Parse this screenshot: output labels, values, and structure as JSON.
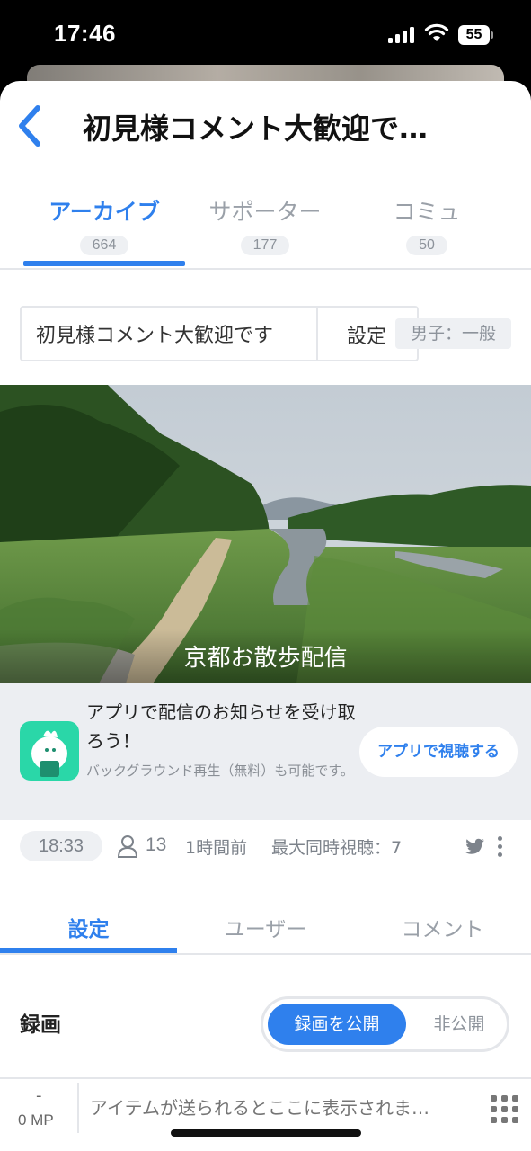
{
  "status_bar": {
    "time": "17:46",
    "battery": "55"
  },
  "header": {
    "title": "初見様コメント大歓迎で…"
  },
  "top_tabs": [
    {
      "label": "アーカイブ",
      "count": "664"
    },
    {
      "label": "サポーター",
      "count": "177"
    },
    {
      "label": "コミュ",
      "count": "50"
    }
  ],
  "stream_info": {
    "title_value": "初見様コメント大歓迎です",
    "settings_label": "設定",
    "category": "男子：一般"
  },
  "thumbnail": {
    "caption": "京都お散歩配信"
  },
  "app_banner": {
    "title": "アプリで配信のお知らせを受け取ろう！",
    "subtitle": "バックグラウンド再生（無料）も可能です。",
    "button_label": "アプリで視聴する"
  },
  "meta": {
    "duration": "18:33",
    "viewers": "13",
    "time_ago": "1時間前",
    "max_concurrent": "最大同時視聴：7"
  },
  "bottom_tabs": [
    "設定",
    "ユーザー",
    "コメント"
  ],
  "recording": {
    "label": "録画",
    "public_option": "録画を公開",
    "private_option": "非公開"
  },
  "bottom_bar": {
    "mp_dash": "-",
    "mp_value": "0 MP",
    "placeholder": "アイテムが送られるとここに表示されま…"
  },
  "colors": {
    "accent": "#2f80ed",
    "app_logo": "#2ad7a8"
  }
}
